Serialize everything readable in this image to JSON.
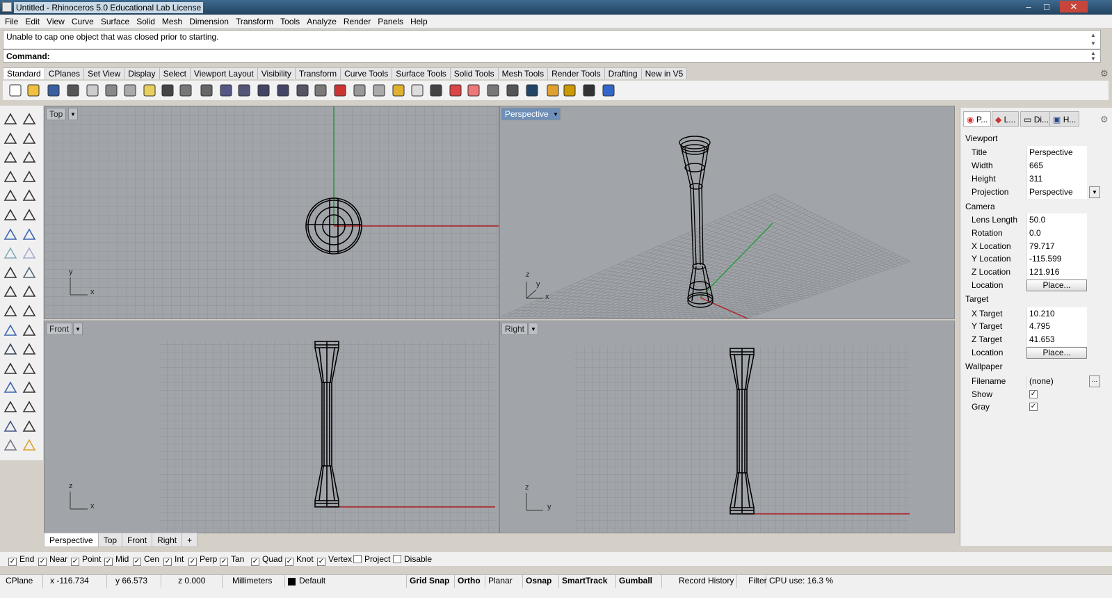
{
  "title": "Untitled - Rhinoceros 5.0 Educational Lab License",
  "window_controls": {
    "minimize": "–",
    "maximize": "□",
    "close": "✕"
  },
  "menu": [
    "File",
    "Edit",
    "View",
    "Curve",
    "Surface",
    "Solid",
    "Mesh",
    "Dimension",
    "Transform",
    "Tools",
    "Analyze",
    "Render",
    "Panels",
    "Help"
  ],
  "history_message": "Unable to cap one object that was closed prior to starting.",
  "command_label": "Command:",
  "toolbar_tabs": [
    "Standard",
    "CPlanes",
    "Set View",
    "Display",
    "Select",
    "Viewport Layout",
    "Visibility",
    "Transform",
    "Curve Tools",
    "Surface Tools",
    "Solid Tools",
    "Mesh Tools",
    "Render Tools",
    "Drafting",
    "New in V5"
  ],
  "toolbar_icons": [
    "new-icon",
    "open-icon",
    "save-icon",
    "print-icon",
    "import-icon",
    "cut-icon",
    "copy-icon",
    "paste-icon",
    "undo-icon",
    "pan-icon",
    "rotate-view-icon",
    "zoom-dynamic-icon",
    "zoom-window-icon",
    "zoom-extents-icon",
    "zoom-selected-icon",
    "undo-view-icon",
    "four-viewports-icon",
    "car-icon",
    "wireframe-icon",
    "ghost-icon",
    "select-icon",
    "light-icon",
    "lock-icon",
    "layer-icon",
    "color-wheel-icon",
    "shaded-icon",
    "rendered-icon",
    "render-icon",
    "properties-icon",
    "options-icon",
    "dimension-icon",
    "help-icon"
  ],
  "left_tools": [
    "select-arrow-icon",
    "point-icon",
    "polyline-icon",
    "curve-icon",
    "circle-icon",
    "ellipse-icon",
    "polygon-arrow-icon",
    "rectangle-icon",
    "polygon-icon",
    "fillet-curve-icon",
    "extend-icon",
    "surface-icon",
    "box-icon",
    "sphere-icon",
    "cylinder-icon",
    "surface-plane-icon",
    "boolean-icon",
    "analyze-icon",
    "split-icon",
    "trim-icon",
    "join-icon",
    "explode-icon",
    "group-icon",
    "point-cloud-icon",
    "text-icon",
    "scale-icon",
    "array-icon",
    "mirror-icon",
    "block-icon",
    "dimension-left-icon",
    "grid-icon",
    "layout-icon",
    "paint-icon",
    "check-icon",
    "solid-icon",
    "draft-icon"
  ],
  "viewports": {
    "top": {
      "label": "Top",
      "axis_a": "y",
      "axis_b": "x"
    },
    "perspective": {
      "label": "Perspective",
      "axis_a": "z",
      "axis_b": "y",
      "axis_c": "x"
    },
    "front": {
      "label": "Front",
      "axis_a": "z",
      "axis_b": "x"
    },
    "right": {
      "label": "Right",
      "axis_a": "z",
      "axis_b": "y"
    }
  },
  "viewport_tabs": [
    "Perspective",
    "Top",
    "Front",
    "Right"
  ],
  "viewport_add": "+",
  "osnaps": [
    {
      "label": "End",
      "checked": true
    },
    {
      "label": "Near",
      "checked": true
    },
    {
      "label": "Point",
      "checked": true
    },
    {
      "label": "Mid",
      "checked": true
    },
    {
      "label": "Cen",
      "checked": true
    },
    {
      "label": "Int",
      "checked": true
    },
    {
      "label": "Perp",
      "checked": true
    },
    {
      "label": "Tan",
      "checked": true
    },
    {
      "label": "Quad",
      "checked": true
    },
    {
      "label": "Knot",
      "checked": true
    },
    {
      "label": "Vertex",
      "checked": true
    },
    {
      "label": "Project",
      "checked": false
    },
    {
      "label": "Disable",
      "checked": false
    }
  ],
  "status": {
    "cplane": "CPlane",
    "x": "x -116.734",
    "y": "y 66.573",
    "z": "z 0.000",
    "units": "Millimeters",
    "layer": "Default",
    "grid_snap": "Grid Snap",
    "ortho": "Ortho",
    "planar": "Planar",
    "osnap": "Osnap",
    "smarttrack": "SmartTrack",
    "gumball": "Gumball",
    "record_history": "Record History",
    "filter": "Filter",
    "cpu": "CPU use: 16.3 %"
  },
  "panel": {
    "tabs": [
      "P...",
      "L...",
      "Di...",
      "H..."
    ],
    "viewport_section": "Viewport",
    "title_k": "Title",
    "title_v": "Perspective",
    "width_k": "Width",
    "width_v": "665",
    "height_k": "Height",
    "height_v": "311",
    "projection_k": "Projection",
    "projection_v": "Perspective",
    "camera_section": "Camera",
    "lens_k": "Lens Length",
    "lens_v": "50.0",
    "rotation_k": "Rotation",
    "rotation_v": "0.0",
    "xloc_k": "X Location",
    "xloc_v": "79.717",
    "yloc_k": "Y Location",
    "yloc_v": "-115.599",
    "zloc_k": "Z Location",
    "zloc_v": "121.916",
    "loc_k": "Location",
    "place": "Place...",
    "target_section": "Target",
    "xt_k": "X Target",
    "xt_v": "10.210",
    "yt_k": "Y Target",
    "yt_v": "4.795",
    "zt_k": "Z Target",
    "zt_v": "41.653",
    "tloc_k": "Location",
    "tplace": "Place...",
    "wallpaper_section": "Wallpaper",
    "file_k": "Filename",
    "file_v": "(none)",
    "file_btn": "...",
    "show_k": "Show",
    "gray_k": "Gray",
    "check": "✓"
  },
  "colors": {
    "viewport_bg": "#a1a5aa",
    "grid": "#8e9297",
    "x_axis": "#b0191e",
    "y_axis": "#1f9a32",
    "active_label": "#6d8fb8"
  }
}
